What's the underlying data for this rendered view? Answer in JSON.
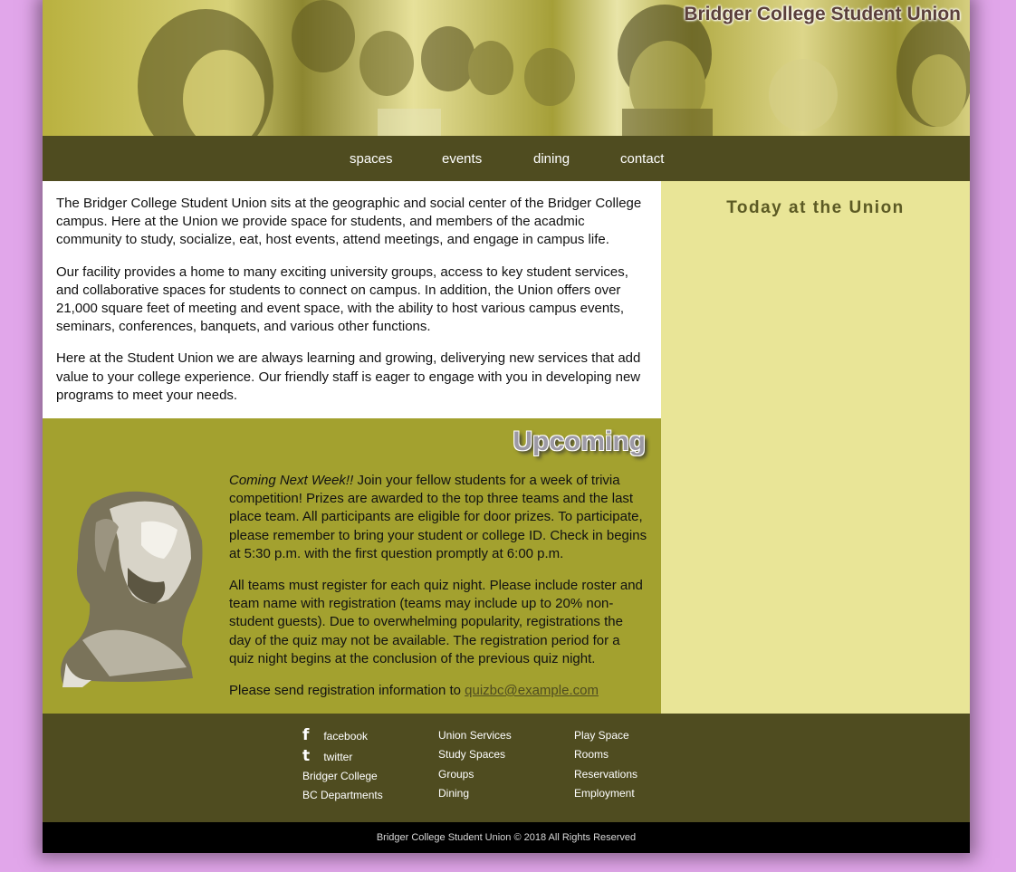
{
  "header": {
    "site_title": "Bridger College Student Union"
  },
  "nav": {
    "items": [
      "spaces",
      "events",
      "dining",
      "contact"
    ]
  },
  "main": {
    "paragraphs": [
      "The Bridger College Student Union sits at the geographic and social center of the Bridger College campus. Here at the Union we provide space for students, and members of the acadmic community to study, socialize, eat, host events, attend meetings, and engage in campus life.",
      "Our facility provides a home to many exciting university groups, access to key student services, and collaborative spaces for students to connect on campus. In addition, the Union offers over 21,000 square feet of meeting and event space, with the ability to host various campus events, seminars, conferences, banquets, and various other functions.",
      "Here at the Student Union we are always learning and growing, deliverying new services that add value to your college experience. Our friendly staff is eager to engage with you in developing new programs to meet your needs."
    ]
  },
  "sidebar": {
    "title": "Today at the Union"
  },
  "upcoming": {
    "title": "Upcoming",
    "lead_italic": "Coming Next Week!!",
    "p1_rest": " Join your fellow students for a week of trivia competition! Prizes are awarded to the top three teams and the last place team. All participants are eligible for door prizes. To participate, please remember to bring your student or college ID. Check in begins at 5:30 p.m. with the first question promptly at 6:00 p.m.",
    "p2": "All teams must register for each quiz night. Please include roster and team name with registration (teams may include up to 20% non-student guests). Due to overwhelming popularity, registrations the day of the quiz may not be available. The registration period for a quiz night begins at the conclusion of the previous quiz night.",
    "p3_prefix": "Please send registration information to ",
    "email": "quizbc@example.com"
  },
  "footer": {
    "col1": {
      "facebook": "facebook",
      "twitter": "twitter",
      "bridger_college": "Bridger College",
      "bc_departments": "BC Departments"
    },
    "col2": [
      "Union Services",
      "Study Spaces",
      "Groups",
      "Dining"
    ],
    "col3": [
      "Play Space",
      "Rooms",
      "Reservations",
      "Employment"
    ]
  },
  "copyright": "Bridger College Student Union © 2018 All Rights Reserved",
  "colors": {
    "page_bg": "#e1a6ea",
    "nav_bg": "#4f4c20",
    "sidebar_bg": "#e9e597",
    "upcoming_bg": "#a3a12f"
  }
}
